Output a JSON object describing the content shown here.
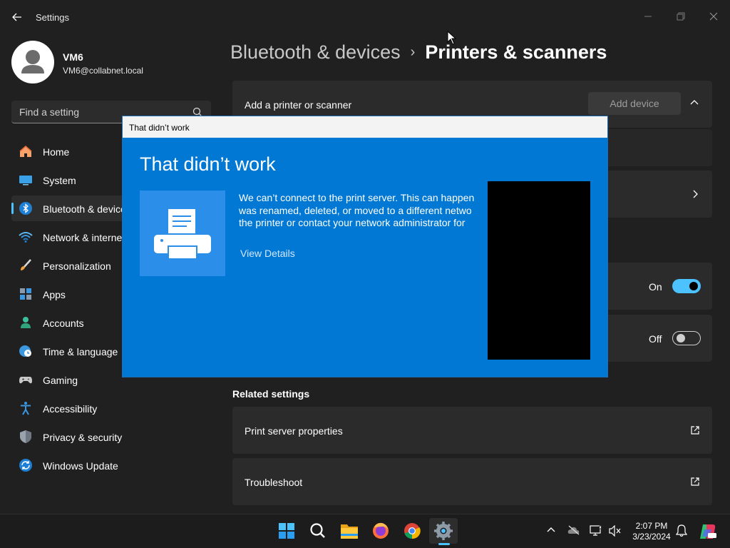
{
  "window": {
    "app_title": "Settings"
  },
  "profile": {
    "name": "VM6",
    "email": "VM6@collabnet.local"
  },
  "search": {
    "placeholder": "Find a setting"
  },
  "sidebar": {
    "items": [
      {
        "label": "Home",
        "icon": "home-icon",
        "active": false
      },
      {
        "label": "System",
        "icon": "system-icon",
        "active": false
      },
      {
        "label": "Bluetooth & devices",
        "icon": "bluetooth-icon",
        "active": true
      },
      {
        "label": "Network & internet",
        "icon": "wifi-icon",
        "active": false
      },
      {
        "label": "Personalization",
        "icon": "brush-icon",
        "active": false
      },
      {
        "label": "Apps",
        "icon": "apps-icon",
        "active": false
      },
      {
        "label": "Accounts",
        "icon": "accounts-icon",
        "active": false
      },
      {
        "label": "Time & language",
        "icon": "clock-globe-icon",
        "active": false
      },
      {
        "label": "Gaming",
        "icon": "gamepad-icon",
        "active": false
      },
      {
        "label": "Accessibility",
        "icon": "accessibility-icon",
        "active": false
      },
      {
        "label": "Privacy & security",
        "icon": "shield-icon",
        "active": false
      },
      {
        "label": "Windows Update",
        "icon": "update-icon",
        "active": false
      }
    ]
  },
  "main": {
    "breadcrumb_parent": "Bluetooth & devices",
    "breadcrumb_separator": "›",
    "breadcrumb_current": "Printers & scanners",
    "add_printer_label": "Add a printer or scanner",
    "add_device_button": "Add device",
    "toggle_1_state": "On",
    "toggle_2_state": "Off",
    "related_settings_title": "Related settings",
    "print_server_label": "Print server properties",
    "troubleshoot_label": "Troubleshoot"
  },
  "dialog": {
    "title": "That didn’t work",
    "heading": "That didn’t work",
    "message_lines": [
      "We can’t connect to the print server. This can happen",
      "was renamed, deleted, or moved to a different netwo",
      "the printer or contact your network administrator for"
    ],
    "link": "View Details"
  },
  "taskbar": {
    "apps": [
      "start-icon",
      "search-icon",
      "file-explorer-icon",
      "firefox-icon",
      "chrome-icon",
      "settings-icon"
    ],
    "time": "2:07 PM",
    "date": "3/23/2024",
    "colors": {
      "accent": "#4cc2ff",
      "dialog_blue": "#0078d4"
    }
  }
}
